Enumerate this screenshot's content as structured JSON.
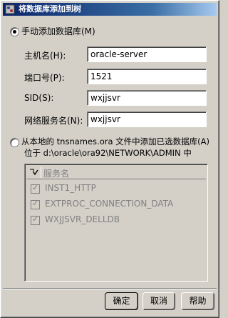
{
  "window": {
    "title": "将数据库添加到树"
  },
  "manual": {
    "radio_label": "手动添加数据库(M)",
    "host_label": "主机名(H):",
    "host_value": "oracle-server",
    "port_label": "端口号(P):",
    "port_value": "1521",
    "sid_label": "SID(S):",
    "sid_value": "wxjjsvr",
    "service_label": "网络服务名(N):",
    "service_value": "wxjjsvr"
  },
  "tns": {
    "radio_label": "从本地的 tnsnames.ora 文件中添加已选数据库(A)",
    "location_line": "位于 d:\\oracle\\ora92\\NETWORK\\ADMIN 中",
    "column_header": "服务名",
    "items": [
      "INST1_HTTP",
      "EXTPROC_CONNECTION_DATA",
      "WXJJSVR_DELLDB"
    ]
  },
  "buttons": {
    "ok": "确定",
    "cancel": "取消",
    "help": "帮助"
  }
}
